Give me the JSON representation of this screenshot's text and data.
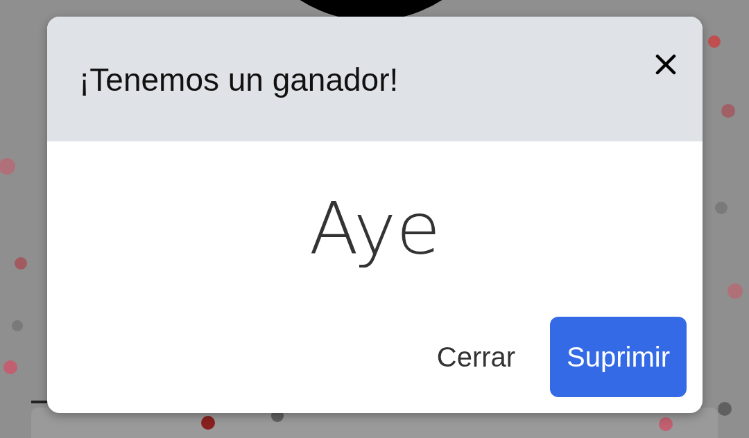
{
  "dialog": {
    "title": "¡Tenemos un ganador!",
    "winner": "Aye",
    "buttons": [
      {
        "label": "Cerrar",
        "kind": "text"
      },
      {
        "label": "Suprimir",
        "kind": "primary"
      }
    ]
  }
}
